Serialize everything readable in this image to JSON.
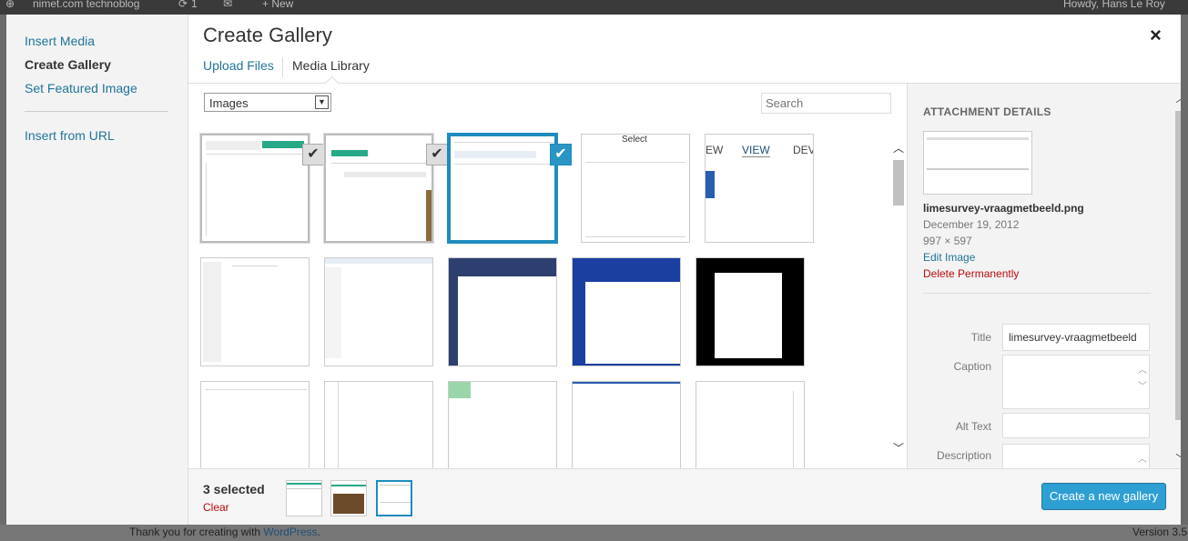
{
  "admin_bar": {
    "site": "nimet.com technoblog",
    "updates": "1",
    "new": "New",
    "howdy": "Howdy, Hans Le Roy"
  },
  "footer": {
    "thanks_prefix": "Thank you for creating with ",
    "thanks_link": "WordPress",
    "thanks_suffix": ".",
    "version": "Version 3.5"
  },
  "menu": {
    "items": [
      {
        "label": "Insert Media",
        "active": false
      },
      {
        "label": "Create Gallery",
        "active": true
      },
      {
        "label": "Set Featured Image",
        "active": false
      },
      {
        "label": "Insert from URL",
        "active": false
      }
    ]
  },
  "header": {
    "title": "Create Gallery",
    "close_symbol": "×"
  },
  "router": {
    "upload_tab": "Upload Files",
    "library_tab": "Media Library"
  },
  "filters": {
    "type_selected": "Images",
    "search_placeholder": "Search"
  },
  "grid": {
    "thumb_text": {
      "select_label": "Select",
      "view_label": "VIEW",
      "dev_label": "DEV"
    }
  },
  "details": {
    "heading": "ATTACHMENT DETAILS",
    "filename": "limesurvey-vraagmetbeeld.png",
    "date": "December 19, 2012",
    "dimensions": "997 × 597",
    "edit_link": "Edit Image",
    "delete_link": "Delete Permanently",
    "title_label": "Title",
    "title_value": "limesurvey-vraagmetbeeld",
    "caption_label": "Caption",
    "alt_label": "Alt Text",
    "description_label": "Description"
  },
  "toolbar": {
    "count": "3 selected",
    "clear": "Clear",
    "create_button": "Create a new gallery"
  },
  "colors": {
    "accent": "#1e8cbe",
    "button": "#2e9fd2",
    "danger": "#bc0b0b",
    "link": "#21759b"
  }
}
